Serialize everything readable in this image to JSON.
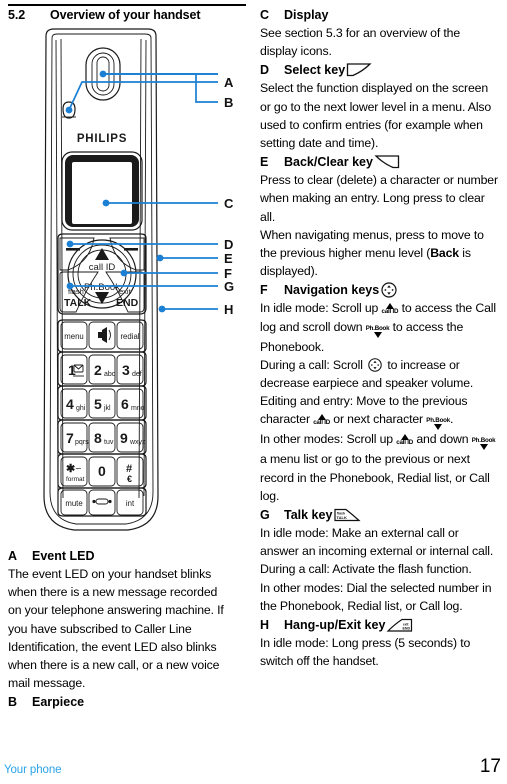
{
  "document": {
    "section_number": "5.2",
    "section_title": "Overview of your handset",
    "footer_text": "Your phone",
    "page_number": "17",
    "accent_color": "#2aa3e8",
    "line_color": "#1b7fd4"
  },
  "diagram": {
    "name": "handset-overview-diagram",
    "brand": "PHILIPS",
    "callouts": [
      "A",
      "B",
      "C",
      "D",
      "E",
      "F",
      "G",
      "H"
    ],
    "nav_labels": {
      "up": "call ID",
      "down": "Ph.Book"
    },
    "left_key": {
      "top": "flash",
      "bottom": "TALK"
    },
    "right_key": {
      "top": "exit",
      "bottom": "END"
    },
    "keypad": [
      [
        {
          "main": "menu",
          "sub": ""
        },
        {
          "main": "speaker-icon",
          "sub": ""
        },
        {
          "main": "redial",
          "sub": ""
        }
      ],
      [
        {
          "main": "1",
          "sub": "voicemail-icon"
        },
        {
          "main": "2",
          "sub": "abc"
        },
        {
          "main": "3",
          "sub": "def"
        }
      ],
      [
        {
          "main": "4",
          "sub": "ghi"
        },
        {
          "main": "5",
          "sub": "jkl"
        },
        {
          "main": "6",
          "sub": "mno"
        }
      ],
      [
        {
          "main": "7",
          "sub": "pqrs"
        },
        {
          "main": "8",
          "sub": "tuv"
        },
        {
          "main": "9",
          "sub": "wxyz"
        }
      ],
      [
        {
          "main": "*",
          "sub": "format"
        },
        {
          "main": "0",
          "sub": ""
        },
        {
          "main": "#",
          "sub": ""
        }
      ],
      [
        {
          "main": "mute",
          "sub": ""
        },
        {
          "main": "headset-icon",
          "sub": ""
        },
        {
          "main": "int",
          "sub": ""
        }
      ]
    ]
  },
  "left_column": {
    "items": [
      {
        "letter": "A",
        "title": "Event LED",
        "paragraphs": [
          "The event LED on your handset blinks when there is a new message recorded on your telephone answering machine. If you have subscribed to Caller Line Identification, the event LED also blinks when there is a new call, or a new voice mail message."
        ]
      },
      {
        "letter": "B",
        "title": "Earpiece",
        "paragraphs": []
      }
    ]
  },
  "right_column": {
    "items": [
      {
        "letter": "C",
        "title": "Display",
        "icon": "",
        "paragraphs": [
          "See section 5.3 for an overview of the display icons."
        ]
      },
      {
        "letter": "D",
        "title": "Select key",
        "icon": "select-key-icon",
        "paragraphs": [
          "Select the function displayed on the screen or go to the next lower level in a menu. Also used to confirm entries (for example when setting date and time)."
        ]
      },
      {
        "letter": "E",
        "title": "Back/Clear key",
        "icon": "back-clear-key-icon",
        "paragraphs": [
          "Press to clear (delete) a character or number when making an entry. Long press to clear all."
        ],
        "paragraph2_pre": "When navigating menus, press to move to the previous higher menu level (",
        "paragraph2_bold": "Back",
        "paragraph2_post": " is displayed)."
      },
      {
        "letter": "F",
        "title": "Navigation keys",
        "icon": "navigation-keys-icon",
        "p1_a": "In idle mode: Scroll up ",
        "p1_b": " to access the Call log and scroll down ",
        "p1_c": " to access the Phonebook.",
        "p2_a": "During a call: Scroll ",
        "p2_b": " to increase or decrease earpiece and speaker volume.",
        "p3_a": "Editing and entry: Move to the previous character ",
        "p3_b": " or next character ",
        "p3_c": ".",
        "p4_a": "In other modes: Scroll up ",
        "p4_b": " and down ",
        "p4_c": " a menu list or go to the previous or next record in the Phonebook, Redial list, or Call log."
      },
      {
        "letter": "G",
        "title": "Talk key",
        "icon": "talk-key-icon",
        "paragraphs": [
          "In idle mode: Make an external call or answer an incoming external or internal call.",
          "During a call: Activate the flash function.",
          "In other modes: Dial the selected number in the Phonebook, Redial list, or Call log."
        ]
      },
      {
        "letter": "H",
        "title": "Hang-up/Exit key",
        "icon": "hangup-exit-key-icon",
        "paragraphs": [
          "In idle mode: Long press (5 seconds) to switch off the handset."
        ]
      }
    ]
  }
}
